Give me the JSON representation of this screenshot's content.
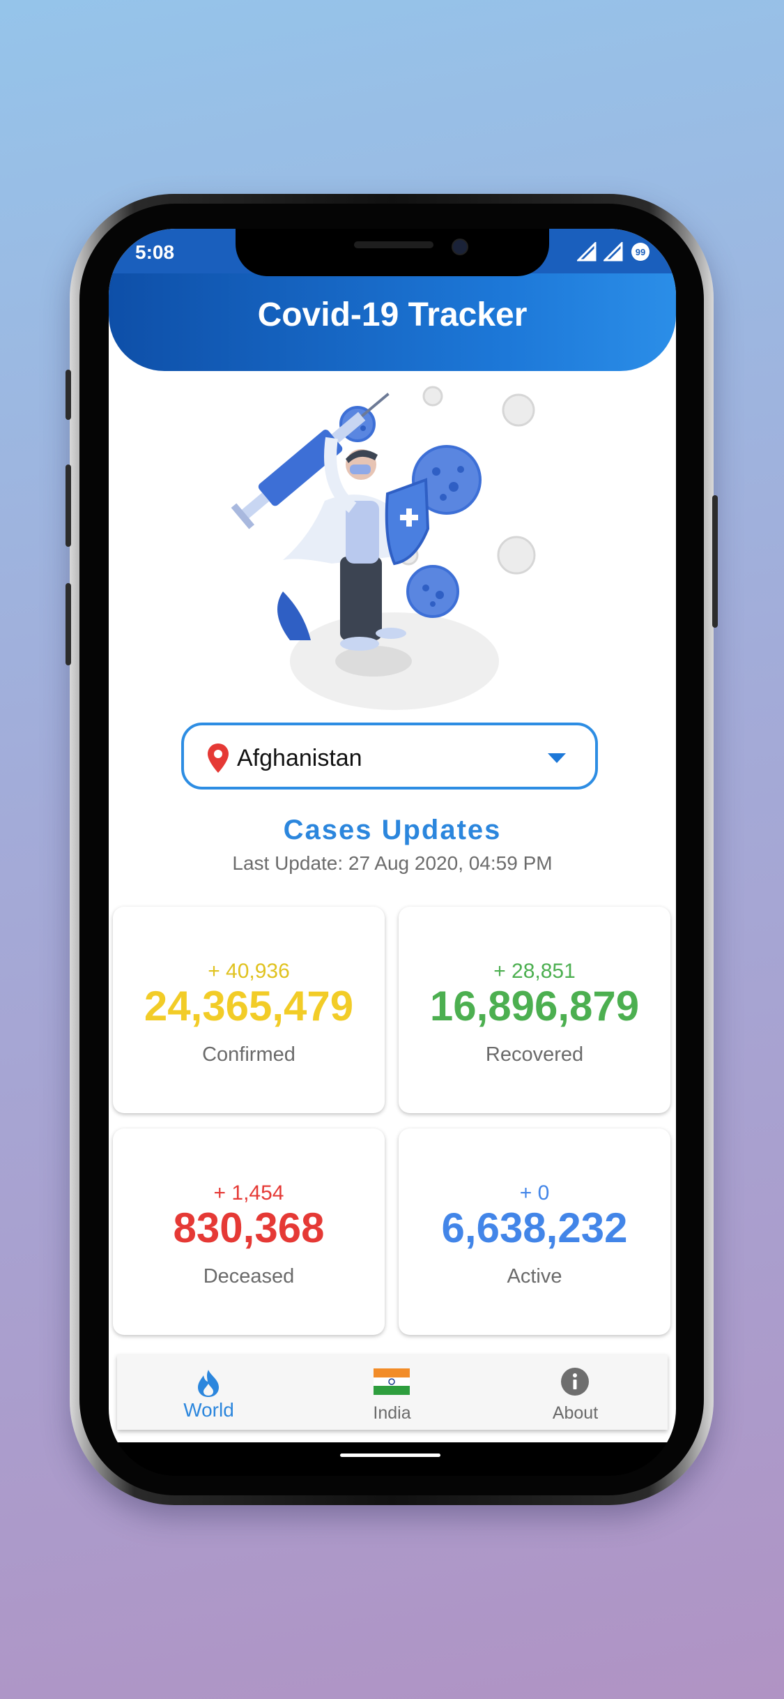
{
  "status_bar": {
    "time": "5:08",
    "battery_level": "99"
  },
  "app": {
    "title": "Covid-19 Tracker"
  },
  "country_select": {
    "selected": "Afghanistan"
  },
  "cases": {
    "title": "Cases Updates",
    "last_update": "Last Update: 27 Aug 2020, 04:59 PM"
  },
  "stats": {
    "confirmed": {
      "delta": "+ 40,936",
      "total": "24,365,479",
      "label": "Confirmed",
      "color": "#f2cc27"
    },
    "recovered": {
      "delta": "+ 28,851",
      "total": "16,896,879",
      "label": "Recovered",
      "color": "#4caf50"
    },
    "deceased": {
      "delta": "+ 1,454",
      "total": "830,368",
      "label": "Deceased",
      "color": "#e53935"
    },
    "active": {
      "delta": "+ 0",
      "total": "6,638,232",
      "label": "Active",
      "color": "#4285e8"
    }
  },
  "bottom_nav": {
    "items": [
      {
        "label": "World",
        "icon": "flame-icon",
        "active": true
      },
      {
        "label": "India",
        "icon": "india-flag-icon",
        "active": false
      },
      {
        "label": "About",
        "icon": "info-icon",
        "active": false
      }
    ]
  },
  "colors": {
    "accent": "#1d78d8",
    "header_dark": "#0e4fa8"
  }
}
